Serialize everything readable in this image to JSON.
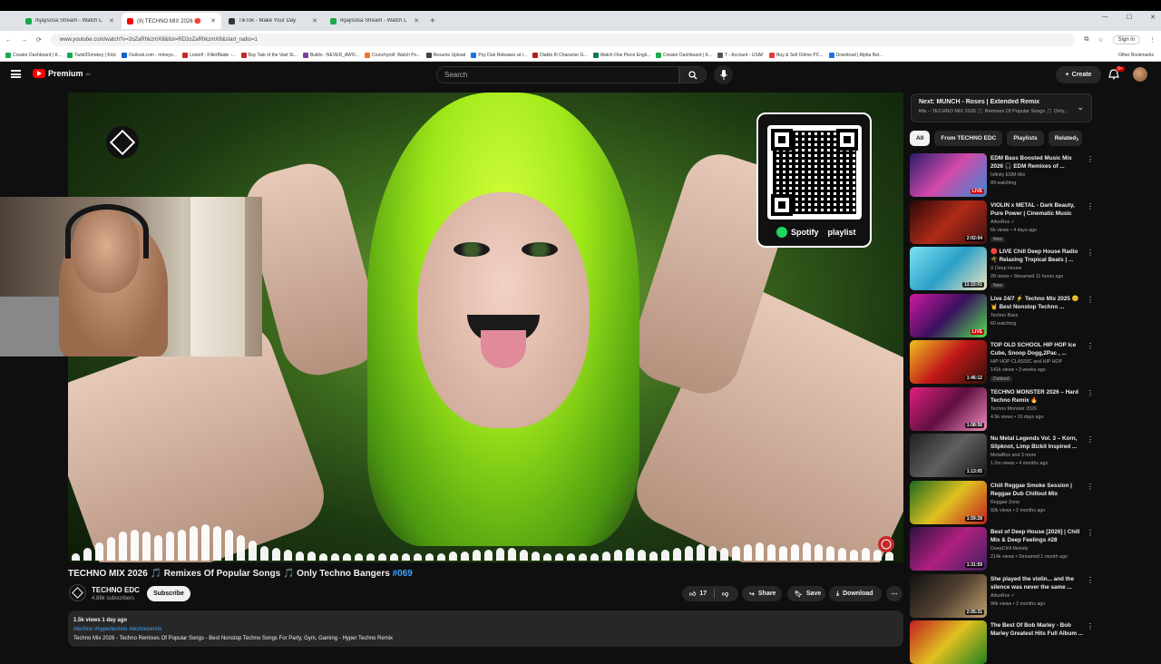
{
  "browser": {
    "tabs": [
      {
        "title": "rkjaysosa Stream - Watch L",
        "color": "#1aa94b"
      },
      {
        "title": "(9) TECHNO MIX 2026 🔴",
        "color": "#ff0000"
      },
      {
        "title": "TikTok - Make Your Day",
        "color": "#333333"
      },
      {
        "title": "rkjaysosa Stream - Watch L",
        "color": "#1aa94b"
      }
    ],
    "url": "www.youtube.com/watch?v=2oZaRhkzmX8&list=RD2oZaRhkzmX8&start_radio=1",
    "sign_in": "Sign in",
    "bookmarks": [
      "Creator Dashboard | K...",
      "Twist3Smokey | Kick",
      "Outlook.com - mrkeyo...",
      "Lootofl - FilterBlade -...",
      "Buy Tale of the Vast St...",
      "Builds - NEVER_AWO...",
      "Crunchyroll: Watch Po...",
      "Resume Upload",
      "Psy Dub Releases at I...",
      "Diablo III Character G...",
      "Watch One Piece Engli...",
      "Creator Dashboard | K...",
      "T - Account - USAF",
      "Buy & Sell Online PC...",
      "Download | Alpha Bet..."
    ],
    "other_bookmarks": "Other Bookmarks"
  },
  "header": {
    "logo_text": "Premium",
    "logo_country": "AU",
    "search_placeholder": "Search",
    "create_label": "Create",
    "notification_count": "9+"
  },
  "player": {
    "qr_caption": "playlist",
    "spotify_label": "Spotify",
    "eq_levels": [
      0.2,
      0.35,
      0.5,
      0.65,
      0.8,
      0.85,
      0.8,
      0.7,
      0.8,
      0.85,
      0.95,
      1.0,
      0.95,
      0.85,
      0.7,
      0.55,
      0.4,
      0.35,
      0.3,
      0.25,
      0.25,
      0.2,
      0.2,
      0.2,
      0.2,
      0.2,
      0.2,
      0.2,
      0.2,
      0.2,
      0.2,
      0.2,
      0.25,
      0.25,
      0.3,
      0.3,
      0.35,
      0.35,
      0.3,
      0.25,
      0.2,
      0.2,
      0.2,
      0.2,
      0.2,
      0.25,
      0.3,
      0.35,
      0.3,
      0.25,
      0.3,
      0.35,
      0.4,
      0.45,
      0.4,
      0.35,
      0.4,
      0.45,
      0.5,
      0.45,
      0.4,
      0.45,
      0.5,
      0.45,
      0.4,
      0.35,
      0.3,
      0.35,
      0.3,
      0.25
    ]
  },
  "video": {
    "title_main": "TECHNO MIX 2026 🎵 Remixes Of Popular Songs 🎵 Only Techno Bangers ",
    "title_tag": "#069",
    "channel_name": "TECHNO EDC",
    "channel_subs": "4.88k subscribers",
    "subscribe_label": "Subscribe",
    "like_count": "17",
    "share_label": "Share",
    "save_label": "Save",
    "download_label": "Download",
    "views_age": "1.5k views  1 day ago",
    "hashtags": "#techno #hypertechno #technoremix",
    "description": "Techno Mix 2026 - Techno Remixes Of Popular Songs - Best Nonstop Techno Songs For Party, Gym, Gaming - Hyper Techno Remix"
  },
  "sidebar": {
    "next_title": "Next: MÜNCH - Roses | Extended Remix",
    "next_sub": "Mix – TECHNO MIX 2026 🎵 Remixes Of Popular Songs 🎵 Only...",
    "chips": [
      "All",
      "From TECHNO EDC",
      "Playlists",
      "Related"
    ],
    "items": [
      {
        "title": "EDM Bass Boosted Music Mix 2026 🎧 EDM Remixes of ...",
        "channel": "Infinity EDM Mix",
        "stats": "89 watching",
        "duration": "LIVE",
        "badge": "",
        "thumb": "linear-gradient(135deg,#2a1c6e,#d14aa8,#3a8ad8)"
      },
      {
        "title": "VIOLIN x METAL - Dark Beauty, Pure Power | Cinematic Music",
        "channel": "AltosRox ✓",
        "stats": "6k views • 4 days ago",
        "duration": "2:02:04",
        "badge": "New",
        "thumb": "linear-gradient(135deg,#2a0808,#b02a18,#401010)"
      },
      {
        "title": "🔴 LIVE Chill Deep House Radio 🌴 Relaxing Tropical Beats | ...",
        "channel": "X Deep House",
        "stats": "28 views • Streamed 11 hours ago",
        "duration": "11:15:01",
        "badge": "New",
        "thumb": "linear-gradient(135deg,#7ee0f0,#2aa0c8,#f0e6c0)"
      },
      {
        "title": "Live 24/7 ⚡ Techno Mix 2025 😊 🤘 Best Nonstop Techno ...",
        "channel": "Techno Bass",
        "stats": "60 watching",
        "duration": "LIVE",
        "badge": "",
        "thumb": "linear-gradient(135deg,#d01aa0,#3a1060,#50e050)"
      },
      {
        "title": "TOP OLD SCHOOL HIP HOP Ice Cube, Snoop Dogg,2Pac , ...",
        "channel": "HIP HOP CLASSIC and HIP HOP",
        "stats": "141k views • 3 weeks ago",
        "duration": "1:46:12",
        "badge": "Dubbed",
        "thumb": "linear-gradient(135deg,#f0c020,#c01818,#301008)"
      },
      {
        "title": "TECHNO MONSTER 2026 – Hard Techno Remix 🔥",
        "channel": "Techno Monster 2026",
        "stats": "4.9k views • 10 days ago",
        "duration": "1:08:56",
        "badge": "",
        "thumb": "linear-gradient(135deg,#e02080,#601040,#f08ac0)"
      },
      {
        "title": "Nu Metal Legends Vol. 3 – Korn, Slipknot, Limp Bizkit Inspired ...",
        "channel": "MetalBox and 3 more",
        "stats": "1.2m views • 4 months ago",
        "duration": "1:13:05",
        "badge": "",
        "thumb": "linear-gradient(135deg,#202020,#606060,#181818)"
      },
      {
        "title": "Chill Reggae Smoke Session | Reggae Dub Chillout Mix",
        "channel": "Reggae Zone",
        "stats": "92k views • 2 months ago",
        "duration": "1:59:28",
        "badge": "",
        "thumb": "linear-gradient(135deg,#1a6a20,#e0c020,#c02020)"
      },
      {
        "title": "Best of Deep House [2026] | Chill Mix & Deep Feelings #28",
        "channel": "DeepChill Melody",
        "stats": "214k views • Streamed 1 month ago",
        "duration": "1:31:59",
        "badge": "",
        "thumb": "linear-gradient(135deg,#301040,#b02080,#402060)"
      },
      {
        "title": "She played the violin... and the silence was never the same ...",
        "channel": "AltosRox ✓",
        "stats": "96k views • 2 months ago",
        "duration": "2:05:31",
        "badge": "",
        "thumb": "linear-gradient(135deg,#101010,#504030,#c0a070)"
      },
      {
        "title": "The Best Of Bob Marley - Bob Marley Greatest Hits Full Album ...",
        "channel": "",
        "stats": "",
        "duration": "",
        "badge": "",
        "thumb": "linear-gradient(135deg,#c02020,#e0c020,#208020)"
      }
    ]
  }
}
